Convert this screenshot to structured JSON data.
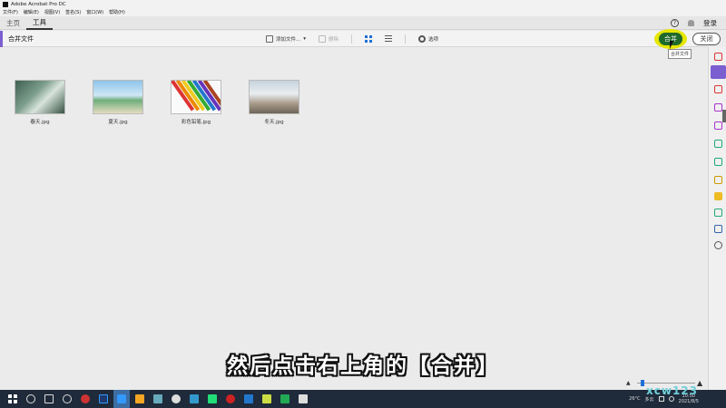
{
  "window": {
    "title": "Adobe Acrobat Pro DC"
  },
  "menu": [
    "文件(F)",
    "编辑(E)",
    "视图(V)",
    "签名(S)",
    "窗口(W)",
    "帮助(H)"
  ],
  "tabs": [
    {
      "label": "主页"
    },
    {
      "label": "工具"
    }
  ],
  "header": {
    "help": "?",
    "signin": "登录"
  },
  "toolbar": {
    "title": "合并文件",
    "add_files": "添加文件...",
    "delete": "删除",
    "options": "选项",
    "combine": "合并",
    "close": "关闭",
    "tooltip": "合并文件"
  },
  "files": [
    {
      "name": "春天.jpg"
    },
    {
      "name": "夏天.jpg"
    },
    {
      "name": "彩色铅笔.jpg"
    },
    {
      "name": "冬天.jpg"
    }
  ],
  "subtitle": "然后点击右上角的【合并】",
  "taskbar": {
    "temp": "26°C",
    "weather": "多云",
    "time_top": "10:50",
    "date": "2021/8/5"
  },
  "watermark": "xcw123",
  "colors": {
    "accent": "#7b5fd0",
    "combine": "#1f6a2a",
    "highlight": "#e6e600"
  }
}
